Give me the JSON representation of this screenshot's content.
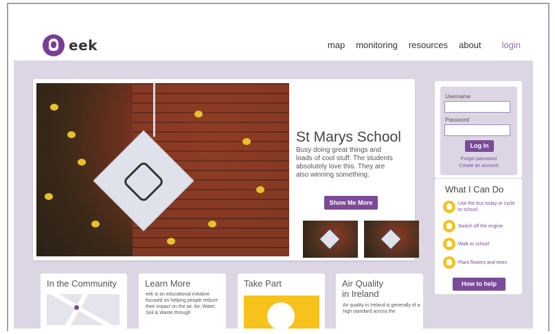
{
  "logo": {
    "text": "eek"
  },
  "nav": {
    "items": [
      "map",
      "monitoring",
      "resources",
      "about"
    ],
    "login": "login"
  },
  "hero": {
    "title": "St Marys School",
    "text": "Busy doing great things and loads of cool stuff. The students absolutely love this. They are also winning something.",
    "button": "Show Me More"
  },
  "login": {
    "username_label": "Username",
    "password_label": "Password",
    "button": "Log In",
    "forgot_line1": "Forgot password",
    "forgot_line2": "Create an account"
  },
  "help": {
    "title": "What I Can Do",
    "items": [
      "Use the bus today or cycle to school",
      "Switch off the engine",
      "Walk to school",
      "Plant flowers and trees"
    ],
    "button": "How to help"
  },
  "cards": {
    "community": {
      "title": "In the Community"
    },
    "learn": {
      "title": "Learn More",
      "text": "eek is an educational initiative focused on helping people reduce their impact on the air. Air, Water, Soil & Waste through"
    },
    "take_part": {
      "title": "Take Part"
    },
    "air": {
      "title_line1": "Air Quality",
      "title_line2": "in Ireland",
      "text": "Air quality in Ireland is generally of a high standard across the"
    }
  }
}
